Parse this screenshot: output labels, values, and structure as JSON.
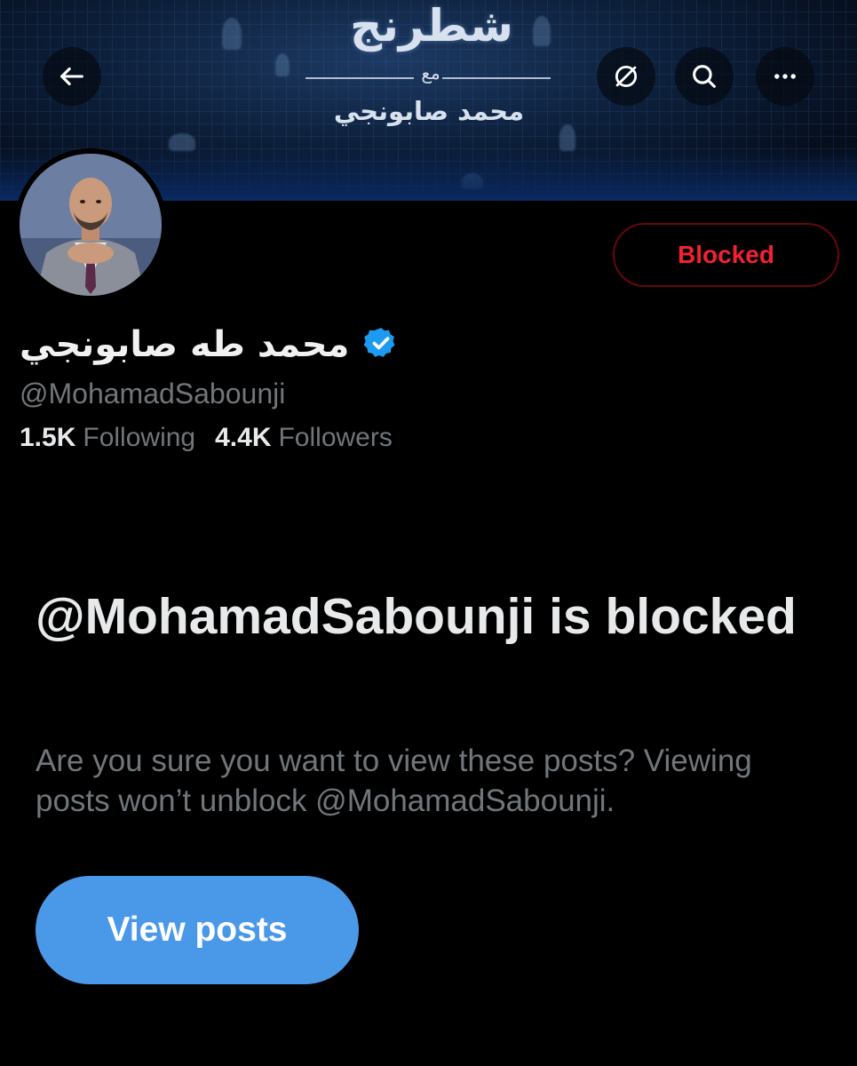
{
  "banner": {
    "title_ar": "شطرنج",
    "with_ar": "مع",
    "name_ar": "محمد صابونجي"
  },
  "toolbar": {
    "back_icon": "arrow-left-icon",
    "translate_icon": "no-translate-icon",
    "search_icon": "search-icon",
    "more_icon": "more-horizontal-icon"
  },
  "profile": {
    "display_name": "محمد طه صابونجي",
    "verified": true,
    "handle": "@MohamadSabounji",
    "following_count": "1.5K",
    "following_label": "Following",
    "followers_count": "4.4K",
    "followers_label": "Followers",
    "blocked_label": "Blocked"
  },
  "blocked_notice": {
    "title": "@MohamadSabounji is blocked",
    "description": "Are you sure you want to view these posts? Viewing posts won’t unblock @MohamadSabounji.",
    "button_label": "View posts"
  },
  "colors": {
    "background": "#000000",
    "accent": "#4a99e9",
    "blocked_red": "#f4212e",
    "muted_text": "#71767b",
    "verified_blue": "#1d9bf0"
  }
}
